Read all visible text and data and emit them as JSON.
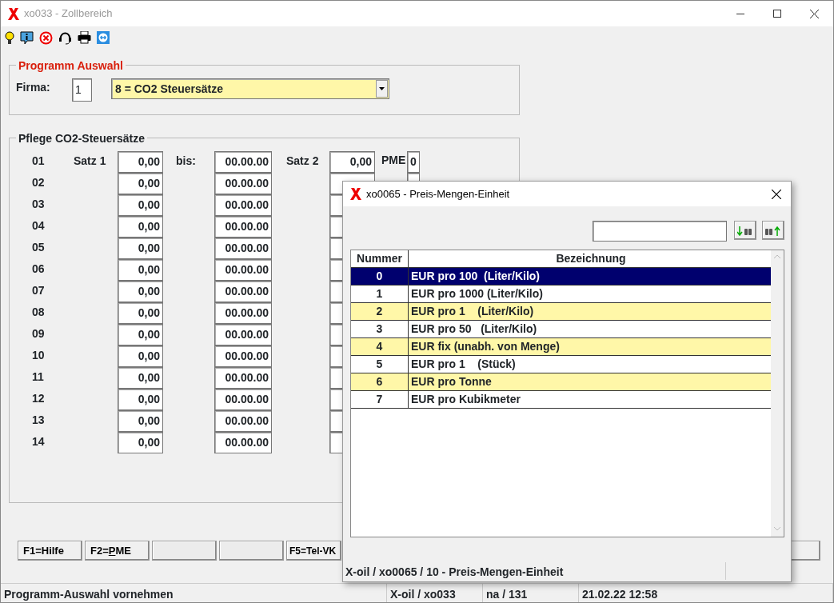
{
  "window": {
    "title": "xo033 - Zollbereich"
  },
  "program_selection": {
    "title": "Programm Auswahl",
    "firma_label": "Firma:",
    "firma_value": "1",
    "selection": "8 = CO2 Steuersätze"
  },
  "rates": {
    "title": "Pflege CO2-Steuersätze",
    "satz1_label": "Satz 1",
    "bis_label": "bis:",
    "satz2_label": "Satz 2",
    "pme_label": "PME",
    "rows": [
      {
        "number": "01",
        "satz1": "0,00",
        "bis": "00.00.00",
        "satz2": "0,00",
        "pme": "0"
      },
      {
        "number": "02",
        "satz1": "0,00",
        "bis": "00.00.00"
      },
      {
        "number": "03",
        "satz1": "0,00",
        "bis": "00.00.00"
      },
      {
        "number": "04",
        "satz1": "0,00",
        "bis": "00.00.00"
      },
      {
        "number": "05",
        "satz1": "0,00",
        "bis": "00.00.00"
      },
      {
        "number": "06",
        "satz1": "0,00",
        "bis": "00.00.00"
      },
      {
        "number": "07",
        "satz1": "0,00",
        "bis": "00.00.00"
      },
      {
        "number": "08",
        "satz1": "0,00",
        "bis": "00.00.00"
      },
      {
        "number": "09",
        "satz1": "0,00",
        "bis": "00.00.00"
      },
      {
        "number": "10",
        "satz1": "0,00",
        "bis": "00.00.00"
      },
      {
        "number": "11",
        "satz1": "0,00",
        "bis": "00.00.00"
      },
      {
        "number": "12",
        "satz1": "0,00",
        "bis": "00.00.00"
      },
      {
        "number": "13",
        "satz1": "0,00",
        "bis": "00.00.00"
      },
      {
        "number": "14",
        "satz1": "0,00",
        "bis": "00.00.00"
      }
    ]
  },
  "function_buttons": [
    {
      "label": "F1=Hilfe"
    },
    {
      "prefix": "F2=",
      "mnemonic": "P",
      "rest": "ME"
    },
    {
      "kind": "blank"
    },
    {
      "kind": "blank"
    },
    {
      "label": "F5=Tel-VK"
    }
  ],
  "status_bar": [
    "Programm-Auswahl vornehmen",
    "X-oil / xo033",
    "na / 131",
    "21.02.22 12:58"
  ],
  "dialog": {
    "title": "xo0065 - Preis-Mengen-Einheit",
    "columns": [
      "Nummer",
      "Bezeichnung"
    ],
    "rows": [
      {
        "number": "0",
        "name": "EUR pro 100  (Liter/Kilo)",
        "selected": true
      },
      {
        "number": "1",
        "name": "EUR pro 1000 (Liter/Kilo)",
        "selected": false
      },
      {
        "number": "2",
        "name": "EUR pro 1    (Liter/Kilo)",
        "selected": false
      },
      {
        "number": "3",
        "name": "EUR pro 50   (Liter/Kilo)",
        "selected": false
      },
      {
        "number": "4",
        "name": "EUR fix (unabh. von Menge)",
        "selected": false
      },
      {
        "number": "5",
        "name": "EUR pro 1    (Stück)",
        "selected": false
      },
      {
        "number": "6",
        "name": "EUR pro Tonne",
        "selected": false
      },
      {
        "number": "7",
        "name": "EUR pro Kubikmeter",
        "selected": false
      }
    ],
    "status": "X-oil / xo0065 / 10 - Preis-Mengen-Einheit"
  }
}
